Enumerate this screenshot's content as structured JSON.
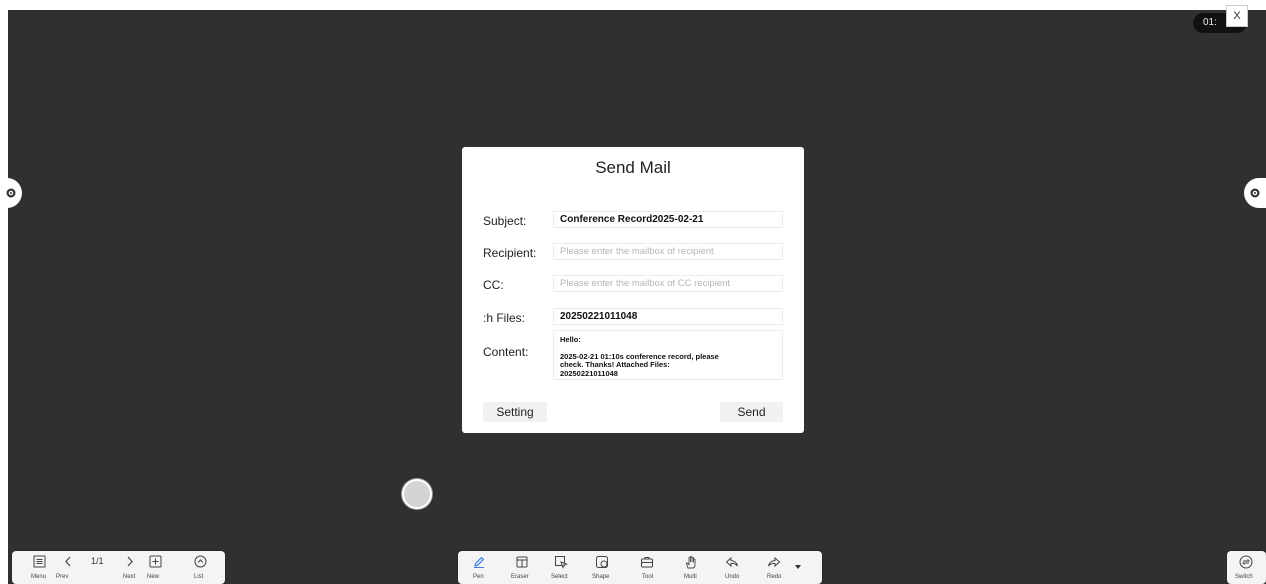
{
  "timer": {
    "text": "01:"
  },
  "close_label": "X",
  "dialog": {
    "title": "Send Mail",
    "subject": {
      "label": "Subject:",
      "value": "Conference Record2025-02-21"
    },
    "recipient": {
      "label": "Recipient:",
      "value": "",
      "placeholder": "Please enter the mailbox of recipient"
    },
    "cc": {
      "label": "CC:",
      "value": "",
      "placeholder": "Please enter the mailbox of CC recipient"
    },
    "attach": {
      "label": ":h Files:",
      "value": "20250221011048"
    },
    "content": {
      "label": "Content:",
      "line1": "Hello:",
      "line2": "2025-02-21 01:10s conference record, please",
      "line3": "check. Thanks! Attached Files:",
      "line4": "20250221011048"
    },
    "setting_label": "Setting",
    "send_label": "Send"
  },
  "left_toolbar": {
    "page": "1/1",
    "labels": {
      "menu": "Menu",
      "prev": "Prev",
      "next": "Next",
      "new": "New",
      "list": "List"
    }
  },
  "center_toolbar": {
    "labels": [
      "Pen",
      "Eraser",
      "Select",
      "Shape",
      "Tool",
      "Multi",
      "Undo",
      "Redo"
    ]
  },
  "right_toolbar": {
    "label": "Switch"
  },
  "colors": {
    "board": "#303032",
    "accent": "#3d7be0"
  }
}
